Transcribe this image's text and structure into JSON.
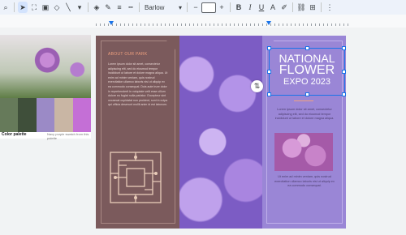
{
  "toolbar": {
    "font_name": "Barlow",
    "font_size": "",
    "icons": [
      "magnify-icon",
      "cursor-icon",
      "crop-icon",
      "image-icon",
      "shapes-icon",
      "line-icon",
      "fill-color-icon",
      "pen-icon",
      "border-weight-icon",
      "border-dash-icon",
      "minus-icon",
      "plus-icon",
      "bold-icon",
      "italic-icon",
      "underline-icon",
      "text-color-icon",
      "highlight-icon",
      "link-icon",
      "comment-icon",
      "more-icon"
    ],
    "glyphs": {
      "magnify": "⌕",
      "cursor": "➤",
      "crop": "⛶",
      "image": "▣",
      "shapes": "◇",
      "line": "╲",
      "dropdown": "▾",
      "fill": "◈",
      "pen": "✎",
      "weight": "≡",
      "dash": "┅",
      "minus": "−",
      "plus": "+",
      "bold": "B",
      "italic": "I",
      "underline": "U",
      "textcolor": "A",
      "highlight": "✐",
      "link": "⛓",
      "comment": "⊞",
      "more": "⋮"
    }
  },
  "left_panel": {
    "label": "Color palette",
    "sublabel": "Navy purple swatch from this palette",
    "swatches": [
      "#667a5a",
      "#3f4f3a",
      "#9b8ac6",
      "#c9b6a4",
      "#c46fd6"
    ]
  },
  "brochure": {
    "panel1": {
      "heading": "ABOUT OUR PARK",
      "body": "Lorem ipsum dolor sit amet, consectetur adipiscing elit, sed do eiusmod tempor incididunt ut labore et dolore magna aliqua. Ut enim ad minim veniam, quis nostrud exercitation ullamco laboris nisi ut aliquip ex ea commodo consequat. Duis aute irure dolor in reprehenderit in voluptate velit esse cillum dolore eu fugiat nulla pariatur. Excepteur sint occaecat cupidatat non proident, sunt in culpa qui officia deserunt mollit anim id est laborum.",
      "colors": {
        "bg": "#7b5a5c",
        "accent": "#f0a07f"
      }
    },
    "panel3": {
      "title_line1": "NATIONAL",
      "title_line2": "FLOWER",
      "title_line3": "EXPO 2023",
      "body1": "Lorem ipsum dolor sit amet, consectetur adipiscing elit, sed do eiusmod tempor incididunt ut labore et dolore magna aliqua.",
      "body2": "Ut enim ad minim veniam, quis nostrud exercitation ullamco laboris nisi ut aliquip ex ea commodo consequat.",
      "colors": {
        "bg": "#9a86d6"
      }
    },
    "side_icon": "⇅"
  }
}
